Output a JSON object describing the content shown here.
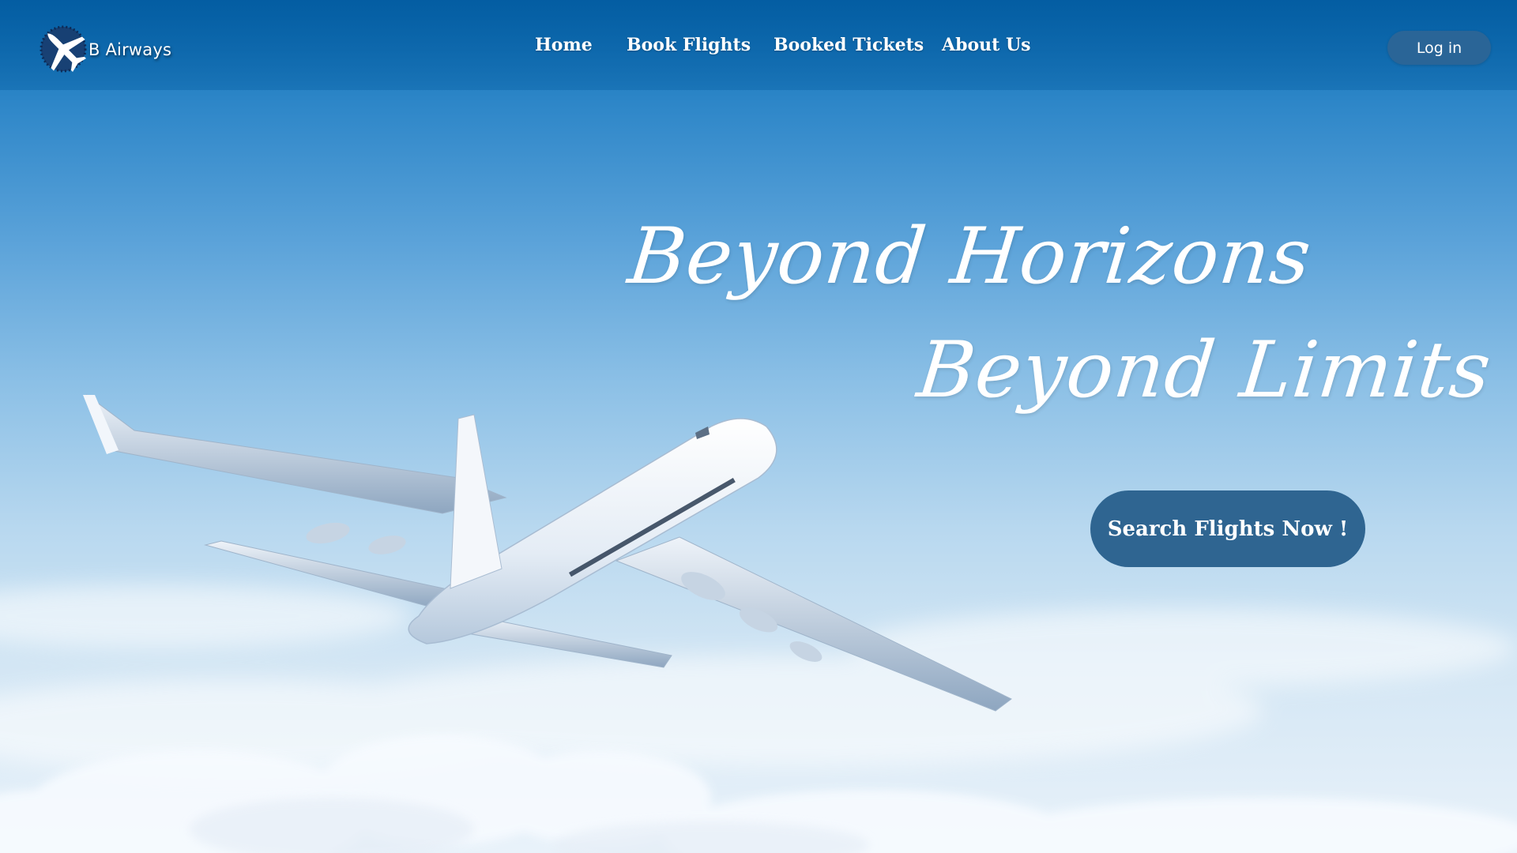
{
  "brand": {
    "name": "B Airways",
    "logo_icon": "airplane-logo-icon"
  },
  "nav": {
    "items": [
      {
        "label": "Home"
      },
      {
        "label": "Book Flights"
      },
      {
        "label": "Booked Tickets"
      },
      {
        "label": "About Us"
      }
    ]
  },
  "header": {
    "login_label": "Log in"
  },
  "hero": {
    "line1": "Beyond Horizons",
    "line2": "Beyond Limits",
    "cta_label": "Search Flights Now !",
    "background_image": "airplane-above-clouds"
  },
  "colors": {
    "header_bg": "#0a70b4",
    "button_bg": "#2f6591",
    "text": "#ffffff"
  }
}
